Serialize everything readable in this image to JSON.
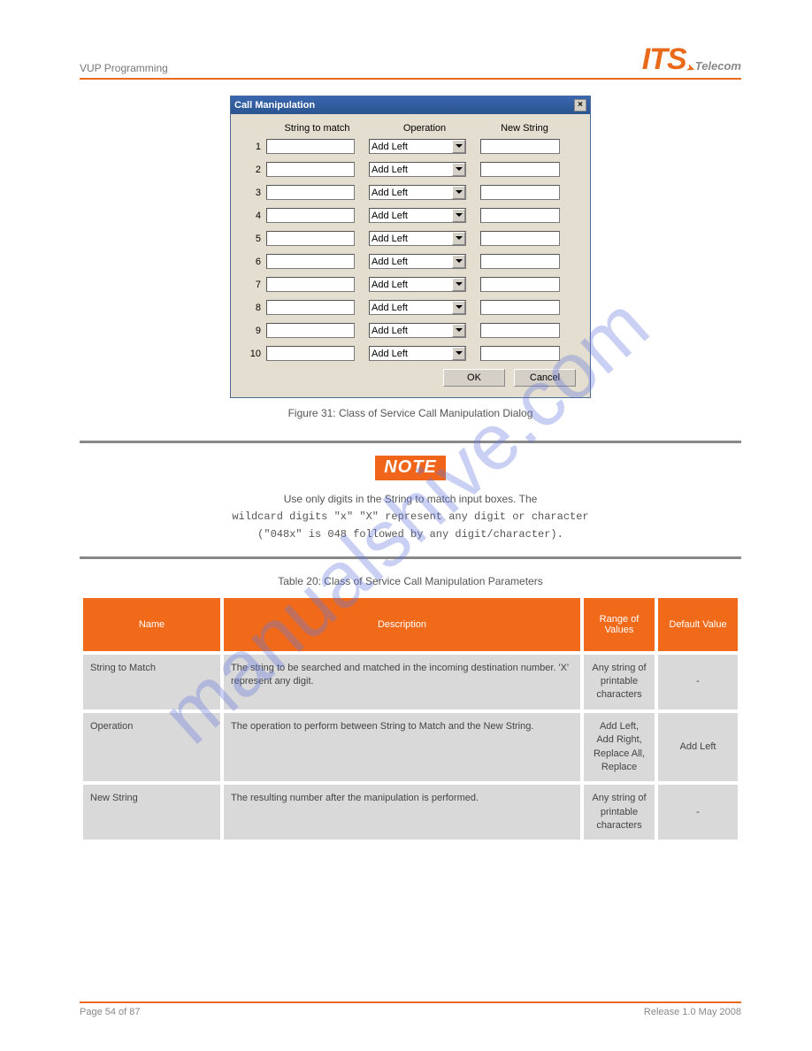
{
  "header_left": "VUP Programming",
  "logo": {
    "its": "ITS",
    "telecom": "Telecom"
  },
  "dialog": {
    "title": "Call Manipulation",
    "cols": {
      "match": "String to match",
      "operation": "Operation",
      "newstr": "New String"
    },
    "rows": [
      {
        "n": "1",
        "op": "Add Left"
      },
      {
        "n": "2",
        "op": "Add Left"
      },
      {
        "n": "3",
        "op": "Add Left"
      },
      {
        "n": "4",
        "op": "Add Left"
      },
      {
        "n": "5",
        "op": "Add Left"
      },
      {
        "n": "6",
        "op": "Add Left"
      },
      {
        "n": "7",
        "op": "Add Left"
      },
      {
        "n": "8",
        "op": "Add Left"
      },
      {
        "n": "9",
        "op": "Add Left"
      },
      {
        "n": "10",
        "op": "Add Left"
      }
    ],
    "ok": "OK",
    "cancel": "Cancel"
  },
  "fig_caption": "Figure 31: Class of Service Call Manipulation Dialog",
  "note_label": "NOTE",
  "note_lines": [
    "Use only digits in the String to match input boxes. The",
    "wildcard digits \"x\" \"X\" represent any digit or character",
    "(\"048x\" is 048 followed by any digit/character)."
  ],
  "table_caption": "Table 20: Class of Service Call Manipulation Parameters",
  "table": {
    "headers": {
      "name": "Name",
      "desc": "Description",
      "range": "Range of Values",
      "def": "Default Value"
    },
    "rows": [
      {
        "name": "String to Match",
        "desc": "The string to be searched and matched in the incoming destination number. 'X' represent any digit.",
        "range": "Any string of printable characters",
        "def": "-"
      },
      {
        "name": "Operation",
        "desc": "The operation to perform between String to Match and the New String.",
        "range": "Add Left, Add Right, Replace All, Replace",
        "def": "Add Left"
      },
      {
        "name": "New String",
        "desc": "The resulting number after the manipulation is performed.",
        "range": "Any string of printable characters",
        "def": "-"
      }
    ]
  },
  "footer": {
    "left": "Page 54 of 87",
    "right": "Release 1.0 May 2008"
  },
  "watermark": "manualshive.com"
}
